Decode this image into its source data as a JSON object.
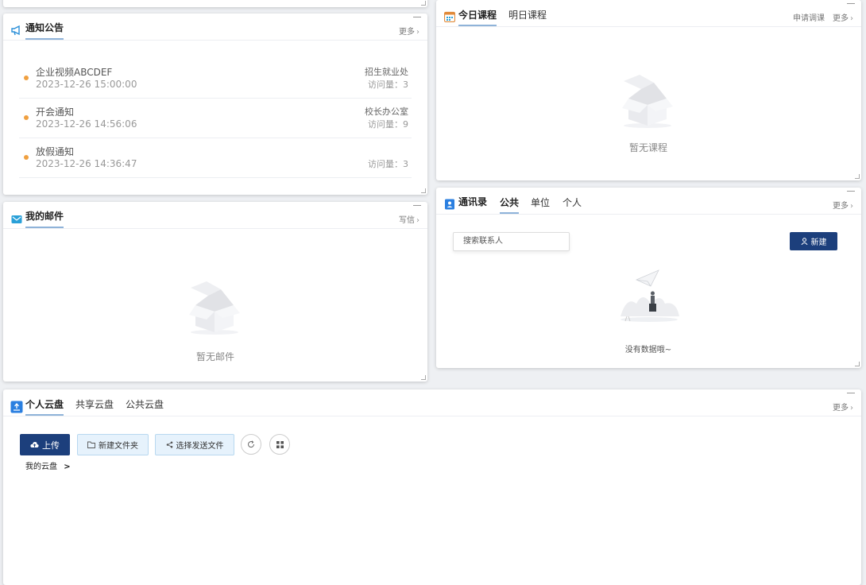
{
  "notice": {
    "title": "通知公告",
    "more": "更多",
    "items": [
      {
        "title": "企业视频ABCDEF",
        "time": "2023-12-26 15:00:00",
        "dept": "招生就业处",
        "visits": "访问量：3"
      },
      {
        "title": "开会通知",
        "time": "2023-12-26 14:56:06",
        "dept": "校长办公室",
        "visits": "访问量：9"
      },
      {
        "title": "放假通知",
        "time": "2023-12-26 14:36:47",
        "dept": "",
        "visits": "访问量：3"
      }
    ]
  },
  "mail": {
    "title": "我的邮件",
    "write": "写信",
    "empty": "暂无邮件"
  },
  "course": {
    "tab_today": "今日课程",
    "tab_tomorrow": "明日课程",
    "apply": "申请调课",
    "more": "更多",
    "empty": "暂无课程"
  },
  "contacts": {
    "title": "通讯录",
    "tabs": [
      "公共",
      "单位",
      "个人"
    ],
    "more": "更多",
    "search_placeholder": "搜索联系人",
    "new_button": "新建",
    "empty": "没有数据哦~"
  },
  "disk": {
    "tabs": [
      "个人云盘",
      "共享云盘",
      "公共云盘"
    ],
    "more": "更多",
    "upload": "上传",
    "new_folder": "新建文件夹",
    "select_send": "选择发送文件",
    "breadcrumb": "我的云盘",
    "breadcrumb_sep": ">"
  },
  "colors": {
    "primary": "#1c3f7c",
    "accent_line": "#8fb3d9",
    "dot": "#f0a040"
  }
}
